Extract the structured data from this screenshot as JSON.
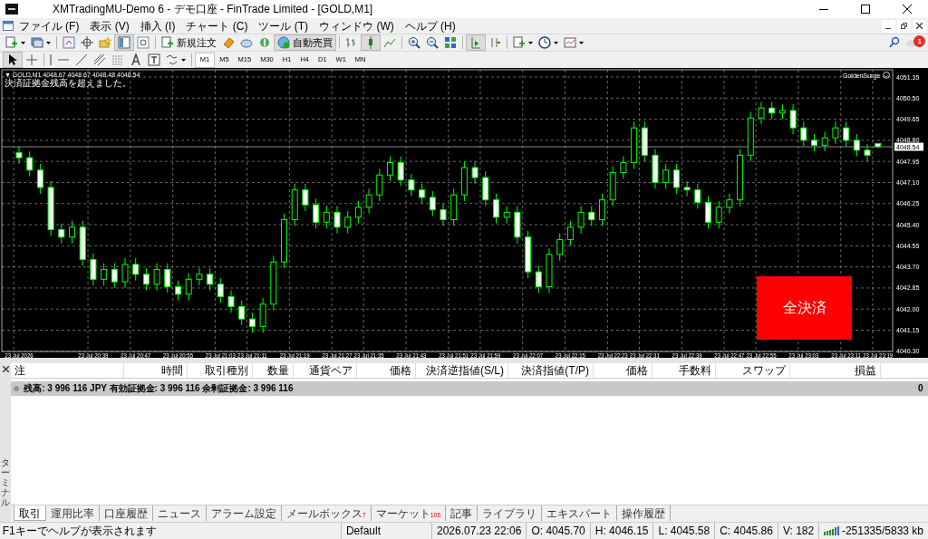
{
  "window": {
    "title": "XMTradingMU-Demo 6 - デモ口座 - FinTrade Limited - [GOLD,M1]"
  },
  "menu": [
    "ファイル (F)",
    "表示 (V)",
    "挿入 (I)",
    "チャート (C)",
    "ツール (T)",
    "ウィンドウ (W)",
    "ヘルプ (H)"
  ],
  "toolbar": {
    "buttons": [
      {
        "label": "新規注文",
        "kind": "order"
      },
      {
        "label": "自動売買",
        "kind": "auto"
      }
    ],
    "notification_count": "1"
  },
  "timeframes": [
    {
      "label": "M1",
      "selected": true
    },
    {
      "label": "M5",
      "selected": false
    },
    {
      "label": "M15",
      "selected": false
    },
    {
      "label": "M30",
      "selected": false
    },
    {
      "label": "H1",
      "selected": false
    },
    {
      "label": "H4",
      "selected": false
    },
    {
      "label": "D1",
      "selected": false
    },
    {
      "label": "W1",
      "selected": false
    },
    {
      "label": "MN",
      "selected": false
    }
  ],
  "chart": {
    "symbol_line": "▼ GOLD,M1  4048.67 4048.67 4048.48 4048.54",
    "message": "決済証拠金残高を超えました。",
    "indicator": "GoldenSurge",
    "close_all_button": "全決済",
    "chart_data": {
      "type": "candlestick",
      "grid": true,
      "ylim": [
        4040.3,
        4051.35
      ],
      "yticks": [
        {
          "value": 4051.35,
          "label": "4051.35"
        },
        {
          "value": 4050.5,
          "label": "4050.50"
        },
        {
          "value": 4049.65,
          "label": "4049.65"
        },
        {
          "value": 4048.8,
          "label": "4048.80"
        },
        {
          "value": 4047.95,
          "label": "4047.95"
        },
        {
          "value": 4047.1,
          "label": "4047.10"
        },
        {
          "value": 4046.25,
          "label": "4046.25"
        },
        {
          "value": 4045.4,
          "label": "4045.40"
        },
        {
          "value": 4044.55,
          "label": "4044.55"
        },
        {
          "value": 4043.7,
          "label": "4043.70"
        },
        {
          "value": 4042.85,
          "label": "4042.85"
        },
        {
          "value": 4042.0,
          "label": "4042.00"
        },
        {
          "value": 4041.15,
          "label": "4041.15"
        },
        {
          "value": 4040.3,
          "label": "4040.30"
        }
      ],
      "ref_lines": [
        {
          "axis": "y",
          "value": 4048.54,
          "label": "4048.54",
          "color": "#888888"
        }
      ],
      "categories": [
        "23 Jul 2026",
        null,
        null,
        null,
        null,
        null,
        null,
        "23 Jul 20:39",
        null,
        null,
        null,
        "23 Jul 20:47",
        null,
        null,
        null,
        "23 Jul 20:55",
        null,
        null,
        null,
        "23 Jul 21:03",
        null,
        null,
        "23 Jul 21:11",
        null,
        null,
        null,
        "23 Jul 21:19",
        null,
        null,
        null,
        "23 Jul 21:27",
        null,
        null,
        "23 Jul 21:35",
        null,
        null,
        null,
        "23 Jul 21:43",
        null,
        null,
        null,
        "23 Jul 21:51",
        null,
        null,
        "23 Jul 21:59",
        null,
        null,
        null,
        "23 Jul 22:07",
        null,
        null,
        null,
        "23 Jul 22:15",
        null,
        null,
        null,
        "23 Jul 22:23",
        null,
        null,
        "23 Jul 22:31",
        null,
        null,
        null,
        "23 Jul 22:39",
        null,
        null,
        null,
        "23 Jul 22:47",
        null,
        null,
        "23 Jul 22:55",
        null,
        null,
        null,
        "23 Jul 23:03",
        null,
        null,
        null,
        "23 Jul 23:11",
        null,
        null,
        "23 Jul 23:19"
      ],
      "ohlc": [
        [
          4048.3,
          4048.55,
          4047.85,
          4048.1
        ],
        [
          4048.1,
          4048.35,
          4047.35,
          4047.6
        ],
        [
          4047.6,
          4047.85,
          4046.65,
          4046.9
        ],
        [
          4046.9,
          4047.15,
          4044.95,
          4045.2
        ],
        [
          4045.2,
          4045.45,
          4044.65,
          4044.9
        ],
        [
          4044.9,
          4045.55,
          4044.65,
          4045.3
        ],
        [
          4045.3,
          4045.55,
          4043.75,
          4044.0
        ],
        [
          4044.0,
          4044.25,
          4042.95,
          4043.2
        ],
        [
          4043.2,
          4043.85,
          4042.95,
          4043.6
        ],
        [
          4043.6,
          4043.85,
          4042.85,
          4043.1
        ],
        [
          4043.1,
          4044.05,
          4042.85,
          4043.8
        ],
        [
          4043.8,
          4044.05,
          4043.15,
          4043.4
        ],
        [
          4043.4,
          4043.65,
          4042.75,
          4043.0
        ],
        [
          4043.0,
          4043.85,
          4042.75,
          4043.6
        ],
        [
          4043.6,
          4043.85,
          4042.65,
          4042.9
        ],
        [
          4042.9,
          4043.15,
          4042.35,
          4042.6
        ],
        [
          4042.6,
          4043.45,
          4042.35,
          4043.2
        ],
        [
          4043.2,
          4043.65,
          4042.95,
          4043.4
        ],
        [
          4043.4,
          4043.65,
          4042.75,
          4043.0
        ],
        [
          4043.0,
          4043.25,
          4042.25,
          4042.5
        ],
        [
          4042.5,
          4042.75,
          4041.85,
          4042.1
        ],
        [
          4042.1,
          4042.35,
          4041.35,
          4041.6
        ],
        [
          4041.6,
          4041.85,
          4041.05,
          4041.3
        ],
        [
          4041.3,
          4042.45,
          4041.05,
          4042.2
        ],
        [
          4042.2,
          4044.15,
          4041.95,
          4043.9
        ],
        [
          4043.9,
          4045.85,
          4043.65,
          4045.6
        ],
        [
          4045.6,
          4047.05,
          4045.35,
          4046.8
        ],
        [
          4046.8,
          4047.05,
          4045.95,
          4046.2
        ],
        [
          4046.2,
          4046.45,
          4045.25,
          4045.5
        ],
        [
          4045.5,
          4046.15,
          4045.25,
          4045.9
        ],
        [
          4045.9,
          4046.15,
          4045.05,
          4045.3
        ],
        [
          4045.3,
          4045.95,
          4045.05,
          4045.7
        ],
        [
          4045.7,
          4046.35,
          4045.45,
          4046.1
        ],
        [
          4046.1,
          4046.85,
          4045.85,
          4046.6
        ],
        [
          4046.6,
          4047.65,
          4046.35,
          4047.4
        ],
        [
          4047.4,
          4048.15,
          4047.15,
          4047.9
        ],
        [
          4047.9,
          4048.15,
          4046.95,
          4047.2
        ],
        [
          4047.2,
          4047.45,
          4046.55,
          4046.8
        ],
        [
          4046.8,
          4047.05,
          4046.25,
          4046.5
        ],
        [
          4046.5,
          4046.75,
          4045.75,
          4046.0
        ],
        [
          4046.0,
          4046.25,
          4045.35,
          4045.6
        ],
        [
          4045.6,
          4046.85,
          4045.35,
          4046.6
        ],
        [
          4046.6,
          4047.95,
          4046.35,
          4047.7
        ],
        [
          4047.7,
          4047.95,
          4047.05,
          4047.3
        ],
        [
          4047.3,
          4047.55,
          4046.15,
          4046.4
        ],
        [
          4046.4,
          4046.65,
          4045.45,
          4045.7
        ],
        [
          4045.7,
          4046.15,
          4045.45,
          4045.9
        ],
        [
          4045.9,
          4046.15,
          4044.65,
          4044.9
        ],
        [
          4044.9,
          4045.15,
          4043.25,
          4043.5
        ],
        [
          4043.5,
          4043.75,
          4042.65,
          4042.9
        ],
        [
          4042.9,
          4044.45,
          4042.65,
          4044.2
        ],
        [
          4044.2,
          4045.05,
          4043.95,
          4044.8
        ],
        [
          4044.8,
          4045.55,
          4044.55,
          4045.3
        ],
        [
          4045.3,
          4046.15,
          4045.05,
          4045.9
        ],
        [
          4045.9,
          4046.15,
          4045.35,
          4045.6
        ],
        [
          4045.6,
          4046.65,
          4045.35,
          4046.4
        ],
        [
          4046.4,
          4047.75,
          4046.15,
          4047.5
        ],
        [
          4047.5,
          4048.15,
          4047.25,
          4047.9
        ],
        [
          4047.9,
          4049.55,
          4047.65,
          4049.3
        ],
        [
          4049.3,
          4049.55,
          4047.95,
          4048.2
        ],
        [
          4048.2,
          4048.45,
          4046.85,
          4047.1
        ],
        [
          4047.1,
          4047.85,
          4046.85,
          4047.6
        ],
        [
          4047.6,
          4047.85,
          4046.65,
          4046.9
        ],
        [
          4046.9,
          4047.15,
          4046.55,
          4046.8
        ],
        [
          4046.8,
          4047.05,
          4046.05,
          4046.3
        ],
        [
          4046.3,
          4046.55,
          4045.25,
          4045.5
        ],
        [
          4045.5,
          4046.35,
          4045.25,
          4046.1
        ],
        [
          4046.1,
          4046.65,
          4045.85,
          4046.4
        ],
        [
          4046.4,
          4048.45,
          4046.15,
          4048.2
        ],
        [
          4048.2,
          4049.95,
          4047.95,
          4049.7
        ],
        [
          4049.7,
          4050.35,
          4049.45,
          4050.1
        ],
        [
          4050.1,
          4050.35,
          4049.65,
          4049.9
        ],
        [
          4049.9,
          4050.25,
          4049.65,
          4050.0
        ],
        [
          4050.0,
          4050.25,
          4049.05,
          4049.3
        ],
        [
          4049.3,
          4049.55,
          4048.55,
          4048.8
        ],
        [
          4048.8,
          4049.05,
          4048.35,
          4048.6
        ],
        [
          4048.6,
          4049.15,
          4048.35,
          4048.9
        ],
        [
          4048.9,
          4049.55,
          4048.65,
          4049.3
        ],
        [
          4049.3,
          4049.55,
          4048.55,
          4048.8
        ],
        [
          4048.8,
          4049.05,
          4048.15,
          4048.4
        ],
        [
          4048.4,
          4048.65,
          4047.95,
          4048.2
        ],
        [
          4048.67,
          4048.67,
          4048.48,
          4048.54
        ]
      ]
    }
  },
  "terminal": {
    "side_title": "ターミナル",
    "columns": [
      "注",
      "時間",
      "取引種別",
      "数量",
      "通貨ペア",
      "価格",
      "決済逆指値(S/L)",
      "決済指値(T/P)",
      "価格",
      "手数料",
      "スワップ",
      "損益"
    ],
    "summary": "残高: 3 996 116 JPY  有効証拠金: 3 996 116  余剰証拠金: 3 996 116",
    "profit": "0",
    "tabs": [
      {
        "label": "取引",
        "selected": true
      },
      {
        "label": "運用比率",
        "selected": false
      },
      {
        "label": "口座履歴",
        "selected": false
      },
      {
        "label": "ニュース",
        "selected": false
      },
      {
        "label": "アラーム設定",
        "selected": false
      },
      {
        "label": "メールボックス",
        "selected": false,
        "count": "7"
      },
      {
        "label": "マーケット",
        "selected": false,
        "count": "105"
      },
      {
        "label": "記事",
        "selected": false
      },
      {
        "label": "ライブラリ",
        "selected": false
      },
      {
        "label": "エキスパート",
        "selected": false
      },
      {
        "label": "操作履歴",
        "selected": false
      }
    ]
  },
  "status_bar": {
    "help": "F1キーでヘルプが表示されます",
    "profile": "Default",
    "datetime": "2026.07.23 22:06",
    "open": "O: 4045.70",
    "high": "H: 4046.15",
    "low": "L: 4045.58",
    "close": "C: 4045.86",
    "volume": "V: 182",
    "traffic": "-251335/5833 kb"
  }
}
